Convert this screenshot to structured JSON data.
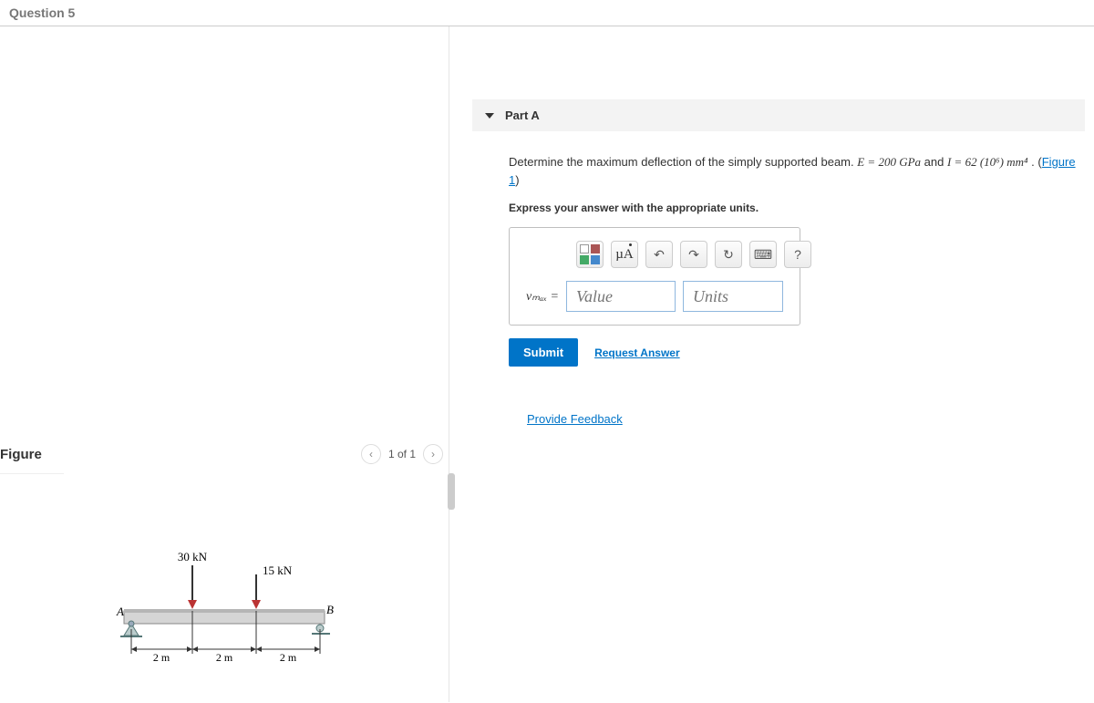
{
  "header": {
    "question_label": "Question 5"
  },
  "figure": {
    "title": "Figure",
    "pager": "1 of 1",
    "load1_label": "30 kN",
    "load2_label": "15 kN",
    "pointA": "A",
    "pointB": "B",
    "dim1": "2 m",
    "dim2": "2 m",
    "dim3": "2 m"
  },
  "part": {
    "label": "Part A",
    "prompt_prefix": "Determine the maximum deflection of the simply supported beam. ",
    "E_expr": "E = 200 GPa",
    "and_text": " and ",
    "I_expr": "I = 62 (10⁶) mm⁴",
    "suffix": " . (",
    "figure_link": "Figure 1",
    "suffix2": ")",
    "instruction": "Express your answer with the appropriate units.",
    "mu_label": "µA",
    "undo_icon": "↶",
    "redo_icon": "↷",
    "reset_icon": "↻",
    "keyboard_icon": "⌨",
    "help_icon": "?",
    "vmax_label": "vₘₐₓ =",
    "value_placeholder": "Value",
    "units_placeholder": "Units",
    "submit": "Submit",
    "request": "Request Answer"
  },
  "feedback": "Provide Feedback"
}
